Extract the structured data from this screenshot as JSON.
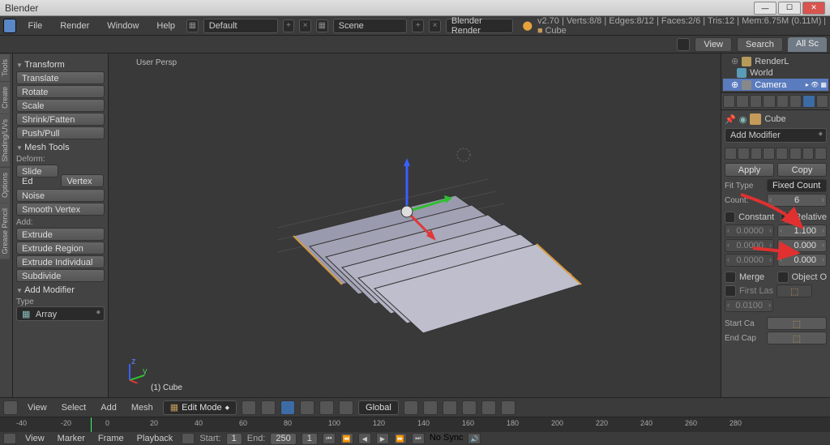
{
  "window": {
    "title": "Blender"
  },
  "menu": {
    "file": "File",
    "render": "Render",
    "window": "Window",
    "help": "Help",
    "layout": "Default",
    "scene": "Scene",
    "engine": "Blender Render",
    "stats_prefix": "v2.70 | Verts:8/8 | Edges:8/12 | Faces:2/6 | Tris:12 | Mem:6.75M (0.11M)",
    "active_obj": "Cube"
  },
  "infobar": {
    "view": "View",
    "search": "Search",
    "allsc": "All Sc"
  },
  "outliner": {
    "items": [
      {
        "label": "RenderL"
      },
      {
        "label": "World"
      },
      {
        "label": "Camera"
      }
    ]
  },
  "vtabs": [
    "Tools",
    "Create",
    "Shading/UVs",
    "Options",
    "Grease Pencil"
  ],
  "toolshelf": {
    "transform_h": "Transform",
    "transform": [
      "Translate",
      "Rotate",
      "Scale",
      "Shrink/Fatten",
      "Push/Pull"
    ],
    "meshtools_h": "Mesh Tools",
    "deform_l": "Deform:",
    "deform": [
      "Slide Ed",
      "Vertex"
    ],
    "noise": "Noise",
    "smooth": "Smooth Vertex",
    "add_l": "Add:",
    "add": [
      "Extrude",
      "Extrude Region",
      "Extrude Individual",
      "Subdivide"
    ],
    "addmod_h": "Add Modifier",
    "type_l": "Type",
    "type_val": "Array"
  },
  "viewport": {
    "persp": "User Persp",
    "obj": "(1) Cube"
  },
  "vphdr": {
    "view": "View",
    "select": "Select",
    "add": "Add",
    "mesh": "Mesh",
    "mode": "Edit Mode",
    "orient": "Global"
  },
  "props": {
    "crumb_obj": "Cube",
    "add_modifier": "Add Modifier",
    "apply": "Apply",
    "copy": "Copy",
    "fit_l": "Fit Type",
    "fit_v": "Fixed Count",
    "count_l": "Count:",
    "count_v": "6",
    "constant": "Constant",
    "relative": "Relative",
    "c_x": "0.0000",
    "c_y": "0.0000",
    "c_z": "0.0000",
    "r_x": "1.100",
    "r_y": "0.000",
    "r_z": "0.000",
    "merge": "Merge",
    "objecto": "Object O",
    "firstlast": "First Las",
    "firstlast_v": "0.0100",
    "startcap": "Start Ca",
    "endcap": "End Cap"
  },
  "timeline": {
    "ticks": [
      "-40",
      "-20",
      "0",
      "20",
      "40",
      "60",
      "80",
      "100",
      "120",
      "140",
      "160",
      "180",
      "200",
      "220",
      "240",
      "260",
      "280"
    ],
    "view": "View",
    "marker": "Marker",
    "frame": "Frame",
    "playback": "Playback",
    "start_l": "Start:",
    "start_v": "1",
    "end_l": "End:",
    "end_v": "250",
    "cur_v": "1",
    "nosync": "No Sync"
  }
}
